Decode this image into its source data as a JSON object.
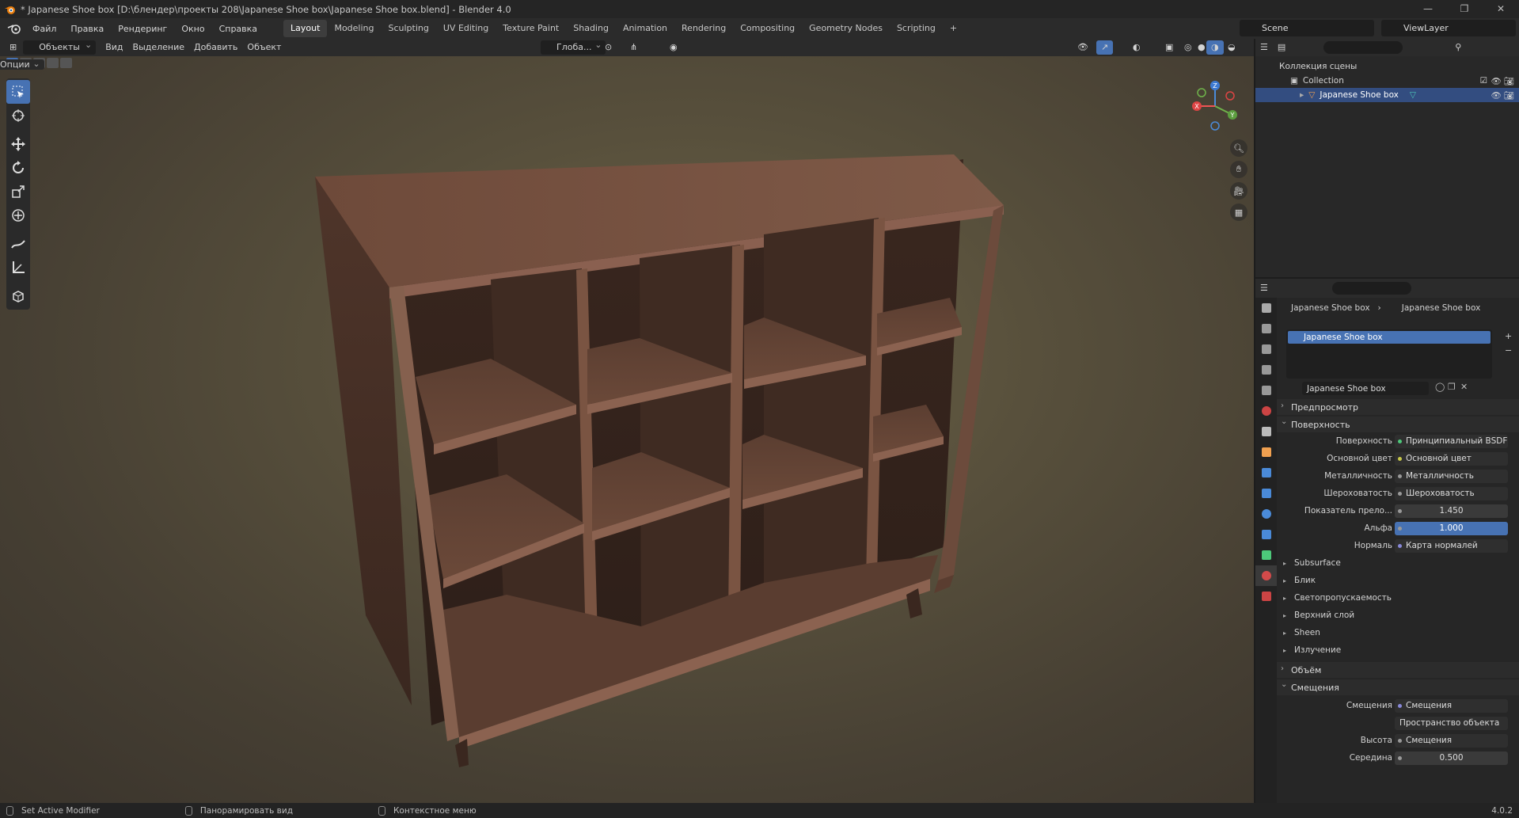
{
  "window": {
    "title": "* Japanese Shoe box [D:\\блендер\\проекты 208\\Japanese Shoe box\\Japanese Shoe box.blend] - Blender 4.0",
    "controls": [
      "—",
      "❐",
      "✕"
    ]
  },
  "menu": {
    "items": [
      "Файл",
      "Правка",
      "Рендеринг",
      "Окно",
      "Справка"
    ]
  },
  "workspaces": {
    "tabs": [
      "Layout",
      "Modeling",
      "Sculpting",
      "UV Editing",
      "Texture Paint",
      "Shading",
      "Animation",
      "Rendering",
      "Compositing",
      "Geometry Nodes",
      "Scripting"
    ],
    "active": "Layout",
    "add": "+"
  },
  "scene": {
    "name": "Scene",
    "view_layer": "ViewLayer"
  },
  "viewport_header": {
    "mode": "Объекты",
    "menus": [
      "Вид",
      "Выделение",
      "Добавить",
      "Объект"
    ],
    "orientation": "Глоба...",
    "options": "Опции"
  },
  "outliner": {
    "scene_collection": "Коллекция сцены",
    "collection": "Collection",
    "object": "Japanese Shoe box"
  },
  "properties": {
    "breadcrumb_object": "Japanese Shoe box",
    "breadcrumb_material": "Japanese Shoe box",
    "slot": "Japanese Shoe box",
    "material_name": "Japanese Shoe box",
    "sections": {
      "preview": "Предпросмотр",
      "surface": "Поверхность",
      "volume": "Объём",
      "displacement": "Смещения"
    },
    "surface_rows": [
      {
        "label": "Поверхность",
        "value": "Принципиальный BSDF"
      },
      {
        "label": "Основной цвет",
        "value": "Основной цвет"
      },
      {
        "label": "Металличность",
        "value": "Металличность"
      },
      {
        "label": "Шероховатость",
        "value": "Шероховатость"
      },
      {
        "label": "Показатель прело...",
        "value": "1.450"
      },
      {
        "label": "Альфа",
        "value": "1.000"
      },
      {
        "label": "Нормаль",
        "value": "Карта нормалей"
      }
    ],
    "subpanels": [
      "Subsurface",
      "Блик",
      "Светопропускаемость",
      "Верхний слой",
      "Sheen",
      "Излучение"
    ],
    "disp_rows": [
      {
        "label": "Смещения",
        "value": "Смещения"
      },
      {
        "label": "",
        "value": "Пространство объекта"
      },
      {
        "label": "Высота",
        "value": "Смещения"
      },
      {
        "label": "Середина",
        "value": "0.500"
      }
    ]
  },
  "status": {
    "items": [
      "Set Active Modifier",
      "Панорамировать вид",
      "Контекстное меню"
    ],
    "version": "4.0.2"
  },
  "colors": {
    "accent": "#4772b3",
    "selected_row": "#334d80",
    "wood_dark": "#3e2a20",
    "wood_mid": "#5a3d2e",
    "wood_light": "#7a5442"
  },
  "axis": {
    "x": "X",
    "y": "Y",
    "z": "Z"
  }
}
